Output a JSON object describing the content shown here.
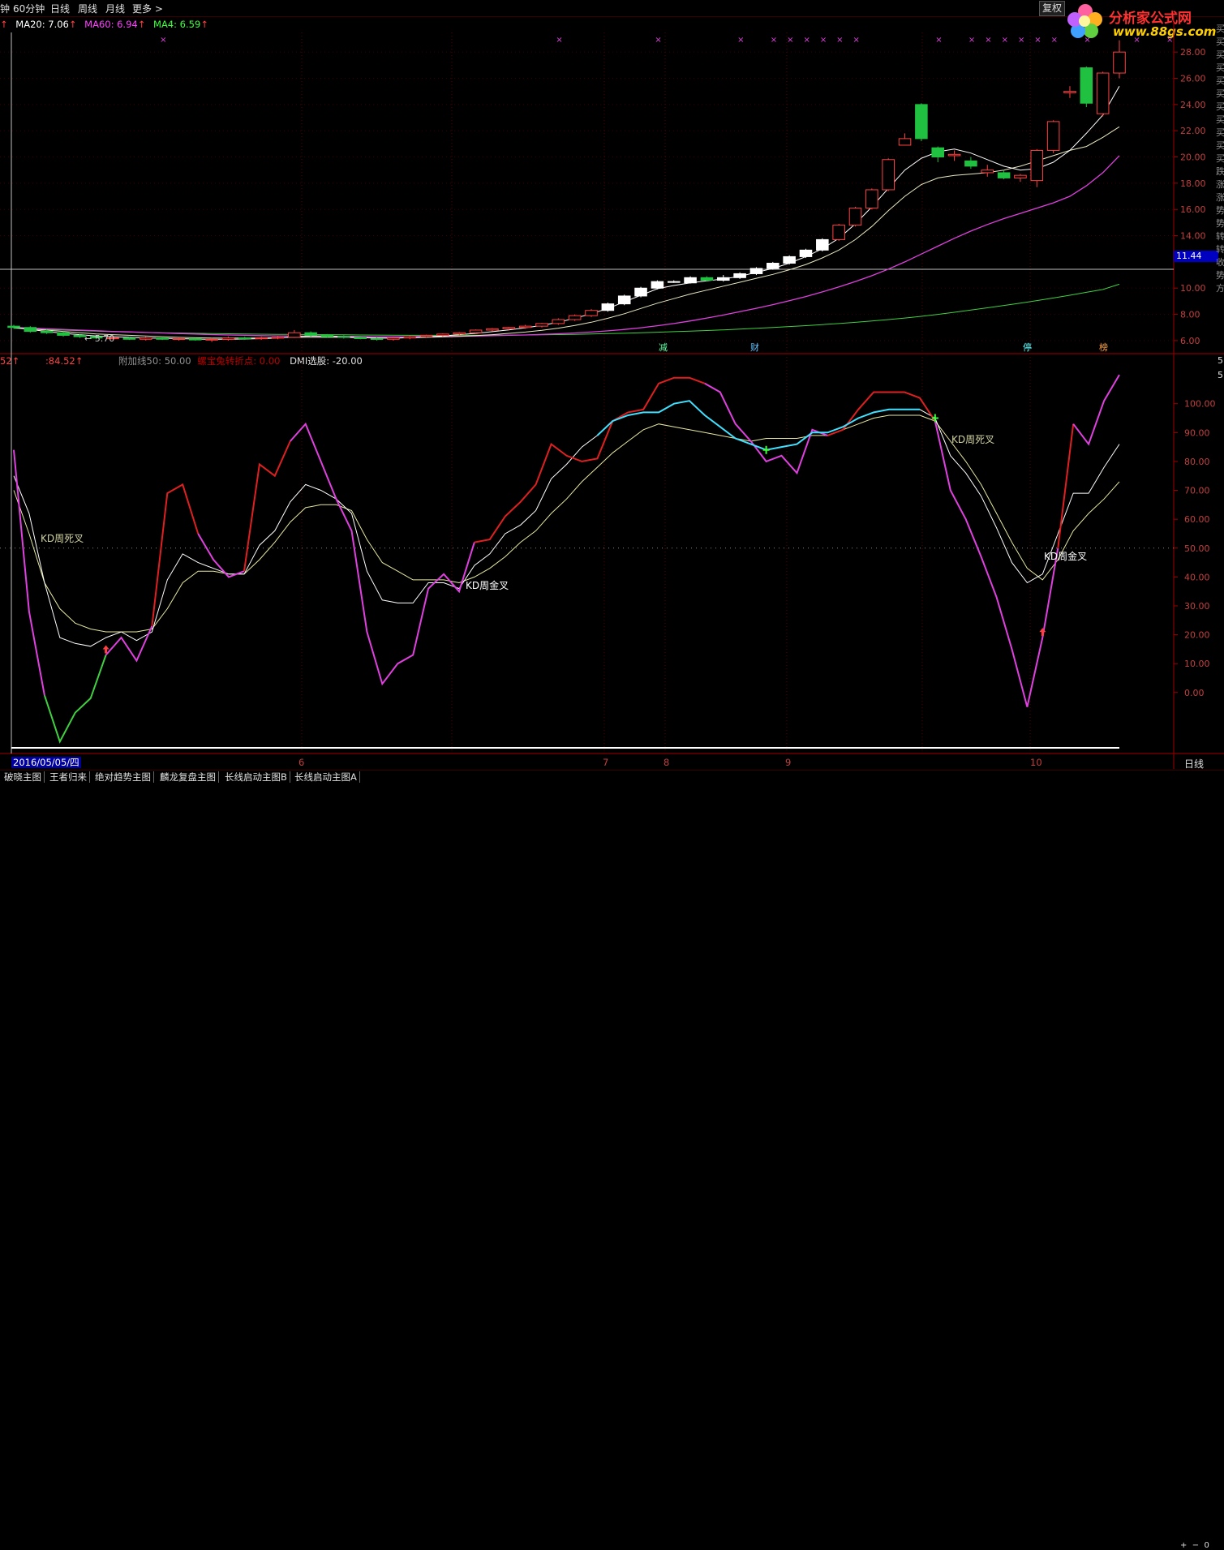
{
  "toolbar": {
    "left_fragment": "钟",
    "tabs": [
      "60分钟",
      "日线",
      "周线",
      "月线",
      "更多 >"
    ],
    "restore": "复权"
  },
  "logo": {
    "brand": "分析家公式网",
    "url": "www.88gs.com"
  },
  "main_indicators": {
    "left_fragment": "↑",
    "ma20_label": "MA20: 7.06",
    "ma60_label": "MA60: 6.94",
    "ma4_label": "MA4: 6.59",
    "arrow": "↑",
    "colors": {
      "ma20": "#ffffff",
      "ma60": "#ff40ff",
      "ma4": "#40ff40"
    }
  },
  "sub_indicators": {
    "left_fragment": "52↑",
    "value_label": ":84.52",
    "arrow": "↑",
    "fujia_label": "附加线50: 50.00",
    "luoxuan_label": "螺宝兔转折点: 0.00",
    "dmi_label": "DMI选股: -20.00"
  },
  "price_axis": {
    "labels": [
      "28.00",
      "26.00",
      "24.00",
      "22.00",
      "20.00",
      "18.00",
      "16.00",
      "14.00",
      "12.00",
      "10.00",
      "8.00",
      "6.00"
    ],
    "current_price": "11.44",
    "low_marker": "← 5.70"
  },
  "right_chars": [
    "买",
    "买",
    "买",
    "买",
    "买",
    "买",
    "买",
    "买",
    "买",
    "买",
    "买",
    "跌",
    "涨",
    "涨",
    "势",
    "势",
    "转",
    "转",
    "收",
    "势",
    "方"
  ],
  "event_markers": [
    {
      "text": "减",
      "color": "#60ffa0"
    },
    {
      "text": "财",
      "color": "#60c0ff"
    },
    {
      "text": "停",
      "color": "#60ffff"
    },
    {
      "text": "榜",
      "color": "#ffa040"
    }
  ],
  "sub_axis": {
    "labels": [
      "100.00",
      "90.00",
      "80.00",
      "70.00",
      "60.00",
      "50.00",
      "40.00",
      "30.00",
      "20.00",
      "10.00",
      "0.00"
    ],
    "top_fragments": [
      "5",
      "5"
    ]
  },
  "kd_annotations": [
    "KD周死叉",
    "KD周金叉",
    "KD周死叉",
    "KD周金叉"
  ],
  "x_axis": {
    "date_box": "2016/05/05/四",
    "months": [
      "6",
      "7",
      "8",
      "9",
      "10"
    ],
    "period": "日线"
  },
  "bottom_tabs": [
    "破晓主图",
    "王者归来",
    "绝对趋势主图",
    "麟龙复盘主图",
    "长线启动主图B",
    "长线启动主图A"
  ],
  "scroll": {
    "plus": "+",
    "minus": "−",
    "zero": "0"
  },
  "chart_data": {
    "type": "candlestick",
    "ylim_price": [
      5.5,
      29
    ],
    "ylim_osc": [
      -20,
      112
    ],
    "candles": [
      [
        7.1,
        7.2,
        6.9,
        7.0
      ],
      [
        7.0,
        7.1,
        6.6,
        6.7
      ],
      [
        6.7,
        6.9,
        6.5,
        6.6
      ],
      [
        6.6,
        6.7,
        6.3,
        6.4
      ],
      [
        6.4,
        6.5,
        6.2,
        6.3
      ],
      [
        6.3,
        6.4,
        6.1,
        6.2
      ],
      [
        6.2,
        6.35,
        6.1,
        6.2
      ],
      [
        6.2,
        6.3,
        6.05,
        6.1
      ],
      [
        6.1,
        6.3,
        6.0,
        6.2
      ],
      [
        6.2,
        6.3,
        6.05,
        6.1
      ],
      [
        6.1,
        6.25,
        6.0,
        6.15
      ],
      [
        6.15,
        6.2,
        6.0,
        6.05
      ],
      [
        6.05,
        6.2,
        5.9,
        6.1
      ],
      [
        6.1,
        6.3,
        6.0,
        6.2
      ],
      [
        6.2,
        6.3,
        6.05,
        6.15
      ],
      [
        6.15,
        6.3,
        6.05,
        6.2
      ],
      [
        6.2,
        6.35,
        6.1,
        6.25
      ],
      [
        6.25,
        6.8,
        6.2,
        6.6
      ],
      [
        6.6,
        6.7,
        6.3,
        6.4
      ],
      [
        6.4,
        6.5,
        6.2,
        6.3
      ],
      [
        6.3,
        6.4,
        6.15,
        6.25
      ],
      [
        6.25,
        6.35,
        6.1,
        6.15
      ],
      [
        6.15,
        6.25,
        6.0,
        6.1
      ],
      [
        6.1,
        6.3,
        6.0,
        6.2
      ],
      [
        6.2,
        6.4,
        6.1,
        6.3
      ],
      [
        6.3,
        6.45,
        6.2,
        6.4
      ],
      [
        6.4,
        6.55,
        6.3,
        6.5
      ],
      [
        6.5,
        6.65,
        6.4,
        6.6
      ],
      [
        6.6,
        6.85,
        6.55,
        6.8
      ],
      [
        6.8,
        6.95,
        6.7,
        6.9
      ],
      [
        6.9,
        7.05,
        6.8,
        7.0
      ],
      [
        7.0,
        7.2,
        6.9,
        7.1
      ],
      [
        7.1,
        7.35,
        7.0,
        7.3
      ],
      [
        7.3,
        7.7,
        7.2,
        7.6
      ],
      [
        7.6,
        8.0,
        7.5,
        7.9
      ],
      [
        7.9,
        8.4,
        7.8,
        8.3
      ],
      [
        8.3,
        8.9,
        8.2,
        8.8
      ],
      [
        8.8,
        9.5,
        8.7,
        9.4
      ],
      [
        9.4,
        10.1,
        9.3,
        10.0
      ],
      [
        10.0,
        10.6,
        9.9,
        10.5
      ],
      [
        10.5,
        10.6,
        10.4,
        10.5
      ],
      [
        10.4,
        10.9,
        10.35,
        10.8
      ],
      [
        10.8,
        10.9,
        10.5,
        10.6
      ],
      [
        10.6,
        11.0,
        10.5,
        10.8
      ],
      [
        10.8,
        11.2,
        10.7,
        11.1
      ],
      [
        11.1,
        11.6,
        11.0,
        11.5
      ],
      [
        11.5,
        12.0,
        11.4,
        11.9
      ],
      [
        11.9,
        12.5,
        11.8,
        12.4
      ],
      [
        12.4,
        13.0,
        12.3,
        12.9
      ],
      [
        12.9,
        13.8,
        12.8,
        13.7
      ],
      [
        13.7,
        14.9,
        13.6,
        14.8
      ],
      [
        14.8,
        16.2,
        14.7,
        16.1
      ],
      [
        16.1,
        17.6,
        16.0,
        17.5
      ],
      [
        17.5,
        19.9,
        17.4,
        19.8
      ],
      [
        20.9,
        21.8,
        21.0,
        21.4
      ],
      [
        24.0,
        24.1,
        21.2,
        21.4
      ],
      [
        20.7,
        20.8,
        19.6,
        20.0
      ],
      [
        20.1,
        20.5,
        19.7,
        20.2
      ],
      [
        19.7,
        20.0,
        19.1,
        19.3
      ],
      [
        18.8,
        19.4,
        18.5,
        19.0
      ],
      [
        18.8,
        19.0,
        18.3,
        18.4
      ],
      [
        18.4,
        18.7,
        18.1,
        18.6
      ],
      [
        18.2,
        20.6,
        17.7,
        20.5
      ],
      [
        20.5,
        22.8,
        20.3,
        22.7
      ],
      [
        24.9,
        25.4,
        24.5,
        25.0
      ],
      [
        26.8,
        26.9,
        23.8,
        24.1
      ],
      [
        23.3,
        26.5,
        23.1,
        26.4
      ],
      [
        26.4,
        28.9,
        26.0,
        28.0
      ]
    ],
    "ma_white_soft": [
      7.0,
      6.9,
      6.8,
      6.7,
      6.6,
      6.5,
      6.45,
      6.4,
      6.35,
      6.3,
      6.25,
      6.22,
      6.2,
      6.2,
      6.2,
      6.2,
      6.22,
      6.25,
      6.25,
      6.25,
      6.25,
      6.22,
      6.2,
      6.2,
      6.22,
      6.25,
      6.28,
      6.32,
      6.38,
      6.45,
      6.55,
      6.65,
      6.78,
      6.95,
      7.15,
      7.4,
      7.7,
      8.05,
      8.45,
      8.85,
      9.2,
      9.55,
      9.85,
      10.15,
      10.45,
      10.75,
      11.05,
      11.4,
      11.8,
      12.3,
      12.9,
      13.7,
      14.7,
      15.9,
      17.0,
      17.9,
      18.4,
      18.6,
      18.7,
      18.8,
      19.0,
      19.3,
      19.7,
      20.1,
      20.5,
      20.8,
      21.5,
      22.3
    ],
    "ma_white_fast": [
      7.0,
      6.85,
      6.7,
      6.55,
      6.45,
      6.35,
      6.3,
      6.25,
      6.2,
      6.18,
      6.15,
      6.12,
      6.1,
      6.1,
      6.12,
      6.15,
      6.2,
      6.3,
      6.35,
      6.35,
      6.3,
      6.25,
      6.2,
      6.2,
      6.22,
      6.28,
      6.35,
      6.45,
      6.55,
      6.68,
      6.82,
      6.98,
      7.15,
      7.4,
      7.7,
      8.05,
      8.45,
      8.95,
      9.45,
      9.95,
      10.2,
      10.4,
      10.55,
      10.7,
      10.9,
      11.2,
      11.5,
      11.9,
      12.4,
      13.0,
      13.8,
      14.9,
      16.2,
      17.6,
      19.0,
      19.9,
      20.4,
      20.6,
      20.3,
      19.8,
      19.3,
      19.0,
      19.1,
      19.6,
      20.5,
      21.8,
      23.2,
      25.4
    ],
    "ma_magenta": [
      7.0,
      6.95,
      6.9,
      6.85,
      6.8,
      6.75,
      6.7,
      6.66,
      6.62,
      6.58,
      6.54,
      6.5,
      6.46,
      6.43,
      6.4,
      6.38,
      6.36,
      6.35,
      6.34,
      6.33,
      6.32,
      6.31,
      6.3,
      6.3,
      6.3,
      6.31,
      6.32,
      6.33,
      6.35,
      6.37,
      6.4,
      6.43,
      6.47,
      6.52,
      6.58,
      6.65,
      6.74,
      6.85,
      6.98,
      7.13,
      7.3,
      7.5,
      7.72,
      7.95,
      8.2,
      8.46,
      8.74,
      9.04,
      9.36,
      9.71,
      10.09,
      10.5,
      10.95,
      11.45,
      12.0,
      12.6,
      13.2,
      13.8,
      14.35,
      14.85,
      15.3,
      15.7,
      16.1,
      16.5,
      17.0,
      17.8,
      18.8,
      20.1
    ],
    "ma_green": [
      6.95,
      6.9,
      6.85,
      6.8,
      6.76,
      6.72,
      6.68,
      6.65,
      6.62,
      6.6,
      6.58,
      6.56,
      6.54,
      6.52,
      6.5,
      6.49,
      6.48,
      6.47,
      6.46,
      6.45,
      6.44,
      6.43,
      6.42,
      6.41,
      6.4,
      6.4,
      6.4,
      6.4,
      6.4,
      6.41,
      6.42,
      6.43,
      6.44,
      6.46,
      6.48,
      6.5,
      6.53,
      6.56,
      6.6,
      6.64,
      6.68,
      6.72,
      6.77,
      6.82,
      6.88,
      6.94,
      7.0,
      7.07,
      7.14,
      7.22,
      7.3,
      7.39,
      7.49,
      7.6,
      7.72,
      7.85,
      8.0,
      8.16,
      8.33,
      8.5,
      8.68,
      8.86,
      9.05,
      9.25,
      9.46,
      9.68,
      9.9,
      10.3
    ],
    "osc_k": [
      84,
      28,
      -1,
      -17,
      -7,
      -2,
      13,
      19,
      11,
      23,
      69,
      72,
      55,
      46,
      40,
      42,
      79,
      75,
      87,
      93,
      80,
      67,
      56,
      21,
      3,
      10,
      13,
      36,
      41,
      35,
      52,
      53,
      61,
      66,
      72,
      86,
      82,
      80,
      81,
      94,
      97,
      98,
      107,
      109,
      109,
      107,
      104,
      93,
      87,
      80,
      82,
      76,
      91,
      89,
      91,
      98,
      104,
      104,
      104,
      102,
      94,
      70,
      60,
      47,
      33,
      15,
      -5,
      19,
      50,
      93,
      86,
      101,
      110
    ],
    "osc_d": [
      75,
      62,
      38,
      19,
      17,
      16,
      19,
      21,
      18,
      21,
      39,
      48,
      45,
      43,
      41,
      41,
      51,
      56,
      66,
      72,
      70,
      67,
      62,
      42,
      32,
      31,
      31,
      38,
      38,
      36,
      44,
      48,
      55,
      58,
      63,
      74,
      79,
      85,
      89,
      94,
      96,
      97,
      97,
      100,
      101,
      96,
      92,
      88,
      86,
      84,
      85,
      86,
      90,
      90,
      92,
      95,
      97,
      98,
      98,
      98,
      95,
      82,
      76,
      68,
      57,
      45,
      38,
      41,
      55,
      69,
      69,
      78,
      86
    ],
    "osc_slow": [
      70,
      55,
      38,
      29,
      24,
      22,
      21,
      21,
      21,
      22,
      29,
      38,
      42,
      42,
      41,
      41,
      46,
      52,
      59,
      64,
      65,
      65,
      63,
      53,
      45,
      42,
      39,
      39,
      39,
      38,
      40,
      43,
      47,
      52,
      56,
      62,
      67,
      73,
      78,
      83,
      87,
      91,
      93,
      92,
      91,
      90,
      89,
      88,
      87,
      88,
      88,
      88,
      89,
      89,
      91,
      93,
      95,
      96,
      96,
      96,
      94,
      87,
      80,
      72,
      62,
      52,
      43,
      39,
      46,
      56,
      62,
      67,
      73
    ]
  }
}
